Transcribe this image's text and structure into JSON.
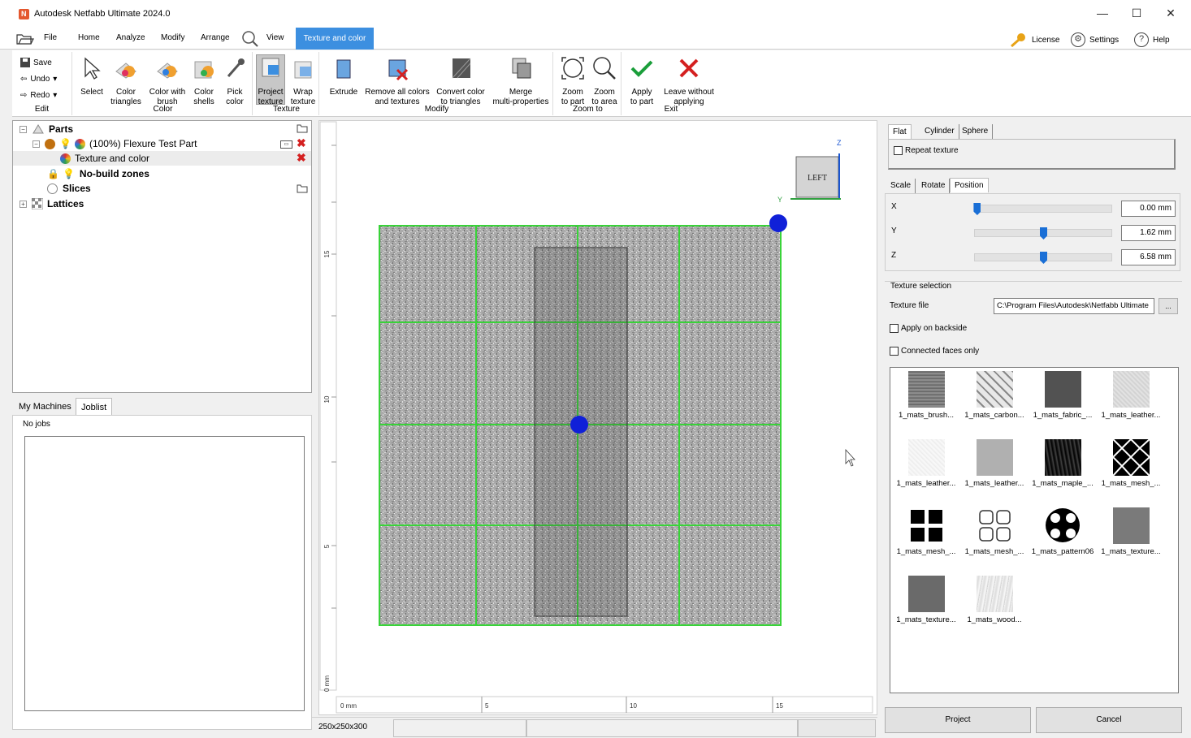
{
  "app": {
    "title": "Autodesk Netfabb Ultimate 2024.0"
  },
  "menu": {
    "items": [
      "File",
      "Home",
      "Analyze",
      "Modify",
      "Arrange",
      "View"
    ],
    "active_tab": "Texture and color",
    "license": "License",
    "settings": "Settings",
    "help": "Help"
  },
  "ribbon": {
    "edit": {
      "save": "Save",
      "undo": "Undo",
      "redo": "Redo",
      "label": "Edit"
    },
    "color": {
      "label": "Color",
      "buttons": [
        {
          "l1": "Select",
          "l2": ""
        },
        {
          "l1": "Color",
          "l2": "triangles"
        },
        {
          "l1": "Color with",
          "l2": "brush"
        },
        {
          "l1": "Color",
          "l2": "shells"
        },
        {
          "l1": "Pick",
          "l2": "color"
        }
      ]
    },
    "texture": {
      "label": "Texture",
      "buttons": [
        {
          "l1": "Project",
          "l2": "texture"
        },
        {
          "l1": "Wrap",
          "l2": "texture"
        }
      ]
    },
    "modify": {
      "label": "Modify",
      "buttons": [
        {
          "l1": "Extrude",
          "l2": ""
        },
        {
          "l1": "Remove all colors",
          "l2": "and textures"
        },
        {
          "l1": "Convert color",
          "l2": "to triangles"
        },
        {
          "l1": "Merge",
          "l2": "multi-properties"
        }
      ]
    },
    "zoom": {
      "label": "Zoom to",
      "buttons": [
        {
          "l1": "Zoom",
          "l2": "to part"
        },
        {
          "l1": "Zoom",
          "l2": "to area"
        }
      ]
    },
    "exit": {
      "label": "Exit",
      "buttons": [
        {
          "l1": "Apply",
          "l2": "to part"
        },
        {
          "l1": "Leave without",
          "l2": "applying"
        }
      ]
    }
  },
  "tree": {
    "parts": "Parts",
    "part_name": "(100%) Flexure Test Part",
    "texture_and_color": "Texture and color",
    "no_build_zones": "No-build zones",
    "slices": "Slices",
    "lattices": "Lattices"
  },
  "machines": {
    "tab_my_machines": "My Machines",
    "tab_joblist": "Joblist",
    "no_jobs": "No jobs"
  },
  "viewport": {
    "ruler_v": [
      "15",
      "10",
      "5",
      "0 mm"
    ],
    "ruler_h": [
      "0 mm",
      "5",
      "10",
      "15"
    ],
    "view_cube": "LEFT",
    "axis_z": "Z",
    "axis_y": "Y",
    "dimensions": "250x250x300"
  },
  "right": {
    "projection_tabs": [
      "Flat",
      "Cylinder",
      "Sphere"
    ],
    "repeat_texture": "Repeat texture",
    "transform_tabs": [
      "Scale",
      "Rotate",
      "Position"
    ],
    "position": [
      {
        "axis": "X",
        "value": "0.00 mm",
        "fraction": 0.02
      },
      {
        "axis": "Y",
        "value": "1.62 mm",
        "fraction": 0.5
      },
      {
        "axis": "Z",
        "value": "6.58 mm",
        "fraction": 0.5
      }
    ],
    "texture_selection": "Texture selection",
    "texture_file_label": "Texture file",
    "texture_file": "C:\\Program Files\\Autodesk\\Netfabb Ultimate",
    "browse": "...",
    "apply_backside": "Apply on backside",
    "connected_faces": "Connected faces only",
    "textures": [
      "1_mats_brush...",
      "1_mats_carbon...",
      "1_mats_fabric_...",
      "1_mats_leather...",
      "1_mats_leather...",
      "1_mats_leather...",
      "1_mats_maple_...",
      "1_mats_mesh_...",
      "1_mats_mesh_...",
      "1_mats_mesh_...",
      "1_mats_pattern06",
      "1_mats_texture...",
      "1_mats_texture...",
      "1_mats_wood..."
    ],
    "project_btn": "Project",
    "cancel_btn": "Cancel"
  }
}
